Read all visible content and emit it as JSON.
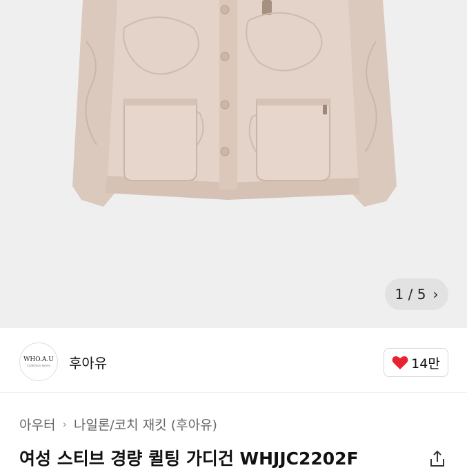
{
  "gallery": {
    "counter": "1 / 5",
    "next_icon": "chevron-right-icon",
    "image_subject": "beige quilted cardigan jacket"
  },
  "seller": {
    "logo_text": "WHO.A.U",
    "logo_subtext": "Collection Series",
    "name": "후아유"
  },
  "likes": {
    "icon": "heart-icon",
    "count": "14만",
    "heart_color": "#e8222e"
  },
  "breadcrumb": {
    "level1": "아우터",
    "level2": "나일론/코치 재킷 (후아유)"
  },
  "product": {
    "title": "여성 스티브 경량 퀼팅 가디건 WHJJC2202F",
    "share_icon": "share-icon"
  }
}
